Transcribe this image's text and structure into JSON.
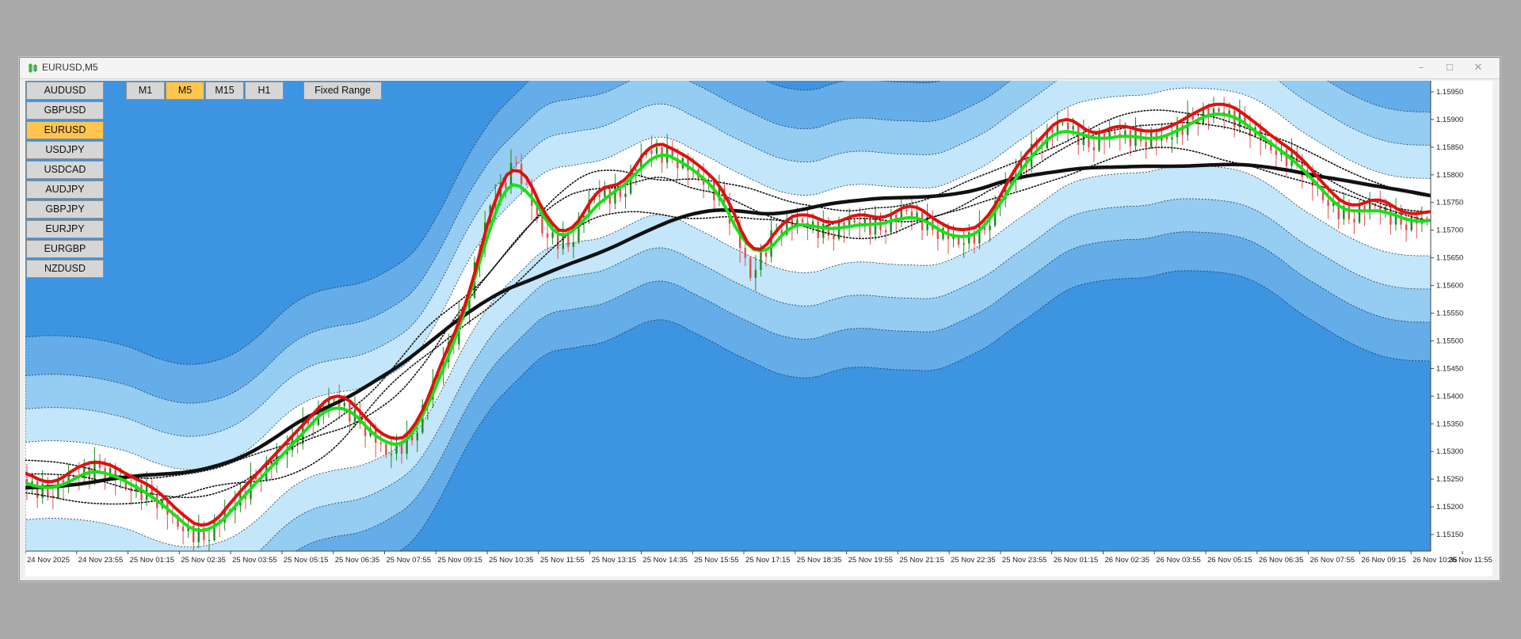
{
  "window": {
    "title": "EURUSD,M5"
  },
  "symbols": [
    "AUDUSD",
    "GBPUSD",
    "EURUSD",
    "USDJPY",
    "USDCAD",
    "AUDJPY",
    "GBPJPY",
    "EURJPY",
    "EURGBP",
    "NZDUSD"
  ],
  "active_symbol": "EURUSD",
  "timeframes": [
    "M1",
    "M5",
    "M15",
    "H1"
  ],
  "active_timeframe": "M5",
  "fixed_range_label": "Fixed Range",
  "colors": {
    "band_dark": "#3d94e0",
    "band_mid": "#64ade8",
    "band_light": "#95ccf2",
    "band_pale": "#c3e6fb",
    "center": "#ffffff",
    "bull_candle": "#1f8a1f",
    "bear_candle": "#e05050",
    "ma_green": "#18e018",
    "ma_red": "#e01010",
    "ma_black": "#111111"
  },
  "chart_data": {
    "type": "candlestick",
    "symbol": "EURUSD",
    "timeframe": "M5",
    "price_axis": [
      "1.15950",
      "1.15900",
      "1.15850",
      "1.15800",
      "1.15750",
      "1.15700",
      "1.15650",
      "1.15600",
      "1.15550",
      "1.15500",
      "1.15450",
      "1.15400",
      "1.15350",
      "1.15300",
      "1.15250",
      "1.15200",
      "1.15150"
    ],
    "ylim": [
      1.1512,
      1.1597
    ],
    "time_axis": [
      "24 Nov 2025",
      "24 Nov 23:55",
      "25 Nov 01:15",
      "25 Nov 02:35",
      "25 Nov 03:55",
      "25 Nov 05:15",
      "25 Nov 06:35",
      "25 Nov 07:55",
      "25 Nov 09:15",
      "25 Nov 10:35",
      "25 Nov 11:55",
      "25 Nov 13:15",
      "25 Nov 14:35",
      "25 Nov 15:55",
      "25 Nov 17:15",
      "25 Nov 18:35",
      "25 Nov 19:55",
      "25 Nov 21:15",
      "25 Nov 22:35",
      "25 Nov 23:55",
      "26 Nov 01:15",
      "26 Nov 02:35",
      "26 Nov 03:55",
      "26 Nov 05:15",
      "26 Nov 06:35",
      "26 Nov 07:55",
      "26 Nov 09:15",
      "26 Nov 10:35",
      "26 Nov 11:55"
    ],
    "price_path": [
      [
        0,
        1.1525
      ],
      [
        3,
        1.1522
      ],
      [
        5,
        1.1526
      ],
      [
        6,
        1.1527
      ],
      [
        7,
        1.1524
      ],
      [
        8,
        1.1522
      ],
      [
        9,
        1.1517
      ],
      [
        10,
        1.1514
      ],
      [
        11,
        1.152
      ],
      [
        12,
        1.1525
      ],
      [
        13,
        1.153
      ],
      [
        14,
        1.1535
      ],
      [
        15,
        1.154
      ],
      [
        16,
        1.1535
      ],
      [
        17,
        1.153
      ],
      [
        18,
        1.1532
      ],
      [
        19,
        1.1545
      ],
      [
        20,
        1.1555
      ],
      [
        21,
        1.1575
      ],
      [
        22,
        1.1582
      ],
      [
        23,
        1.157
      ],
      [
        24,
        1.1567
      ],
      [
        25,
        1.1577
      ],
      [
        26,
        1.1576
      ],
      [
        27,
        1.1585
      ],
      [
        28,
        1.1583
      ],
      [
        29,
        1.158
      ],
      [
        30,
        1.1575
      ],
      [
        31,
        1.1562
      ],
      [
        32,
        1.157
      ],
      [
        33,
        1.1572
      ],
      [
        34,
        1.1569
      ],
      [
        35,
        1.1572
      ],
      [
        36,
        1.157
      ],
      [
        37,
        1.1574
      ],
      [
        38,
        1.157
      ],
      [
        39,
        1.1568
      ],
      [
        40,
        1.157
      ],
      [
        41,
        1.158
      ],
      [
        42,
        1.1585
      ],
      [
        43,
        1.159
      ],
      [
        44,
        1.1585
      ],
      [
        45,
        1.1588
      ],
      [
        46,
        1.1586
      ],
      [
        47,
        1.1587
      ],
      [
        48,
        1.159
      ],
      [
        49,
        1.1592
      ],
      [
        50,
        1.1589
      ],
      [
        51,
        1.1585
      ],
      [
        52,
        1.1582
      ],
      [
        53,
        1.1576
      ],
      [
        54,
        1.1572
      ],
      [
        55,
        1.1575
      ],
      [
        56,
        1.1571
      ],
      [
        57,
        1.1572
      ]
    ],
    "moving_averages": [
      {
        "color": "green",
        "style": "thick"
      },
      {
        "color": "red",
        "style": "thick"
      },
      {
        "color": "black",
        "style": "thick"
      },
      {
        "color": "black",
        "style": "dotted"
      }
    ]
  }
}
